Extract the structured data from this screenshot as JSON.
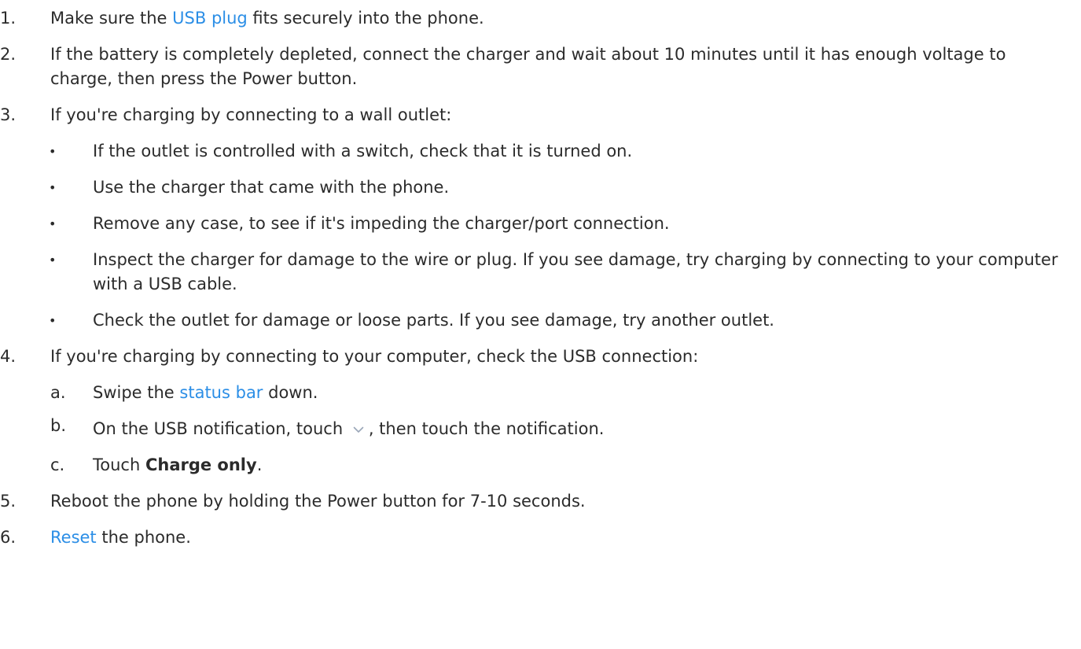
{
  "steps": [
    {
      "num": "1.",
      "before": "Make sure the ",
      "link": "USB plug",
      "after": " fits securely into the phone."
    },
    {
      "num": "2.",
      "text": "If the battery is completely depleted, connect the charger and wait about 10 minutes until it has enough voltage to charge, then press the Power button."
    },
    {
      "num": "3.",
      "text": "If you're charging by connecting to a wall outlet:"
    },
    {
      "num": "4.",
      "text": "If you're charging by connecting to your computer, check the USB connection:"
    },
    {
      "num": "5.",
      "text": "Reboot the phone by holding the Power button for 7-10 seconds."
    },
    {
      "num": "6.",
      "link": "Reset",
      "after": " the phone."
    }
  ],
  "wall_outlet_bullets": [
    "If the outlet is controlled with a switch, check that it is turned on.",
    "Use the charger that came with the phone.",
    "Remove any case, to see if it's impeding the charger/port connection.",
    "Inspect the charger for damage to the wire or plug. If you see damage, try charging by connecting to your computer with a USB cable.",
    "Check the outlet for damage or loose parts. If you see damage, try another outlet."
  ],
  "bullet_glyph": "•",
  "usb_substeps": [
    {
      "letter": "a.",
      "before": "Swipe the ",
      "link": "status bar",
      "after": " down."
    },
    {
      "letter": "b.",
      "before": "On the USB notification, touch ",
      "icon": "chevron-down-icon",
      "after": ", then touch the notification."
    },
    {
      "letter": "c.",
      "before": "Touch ",
      "bold": "Charge only",
      "after": "."
    }
  ],
  "colors": {
    "text": "#2b2b2b",
    "link": "#2b8ee6",
    "icon": "#9aa6b8"
  }
}
